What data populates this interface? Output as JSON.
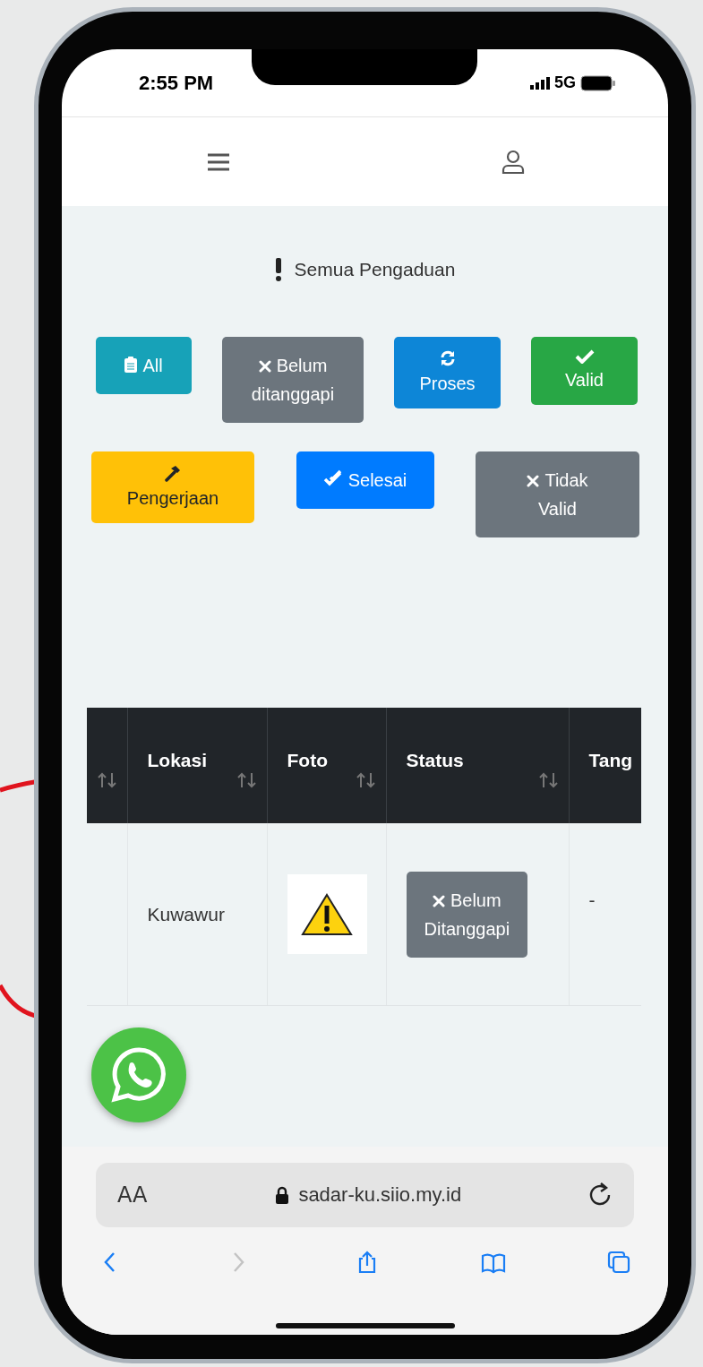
{
  "status_bar": {
    "time": "2:55 PM",
    "network": "5G"
  },
  "page_title": "Semua Pengaduan",
  "filter_rows": [
    [
      {
        "label": "All",
        "kind": "all",
        "color": "#17a2b8"
      },
      {
        "label": "Belum\nditanggapi",
        "kind": "pending",
        "color": "#6c757d"
      },
      {
        "label": "Proses",
        "kind": "process",
        "color": "#0d86d7"
      },
      {
        "label": "Valid",
        "kind": "valid",
        "color": "#28a745"
      }
    ],
    [
      {
        "label": "Pengerjaan",
        "kind": "work",
        "color": "#ffc107"
      },
      {
        "label": "Selesai",
        "kind": "done",
        "color": "#007bff"
      },
      {
        "label": "Tidak\nValid",
        "kind": "invalid",
        "color": "#6c757d"
      }
    ]
  ],
  "table": {
    "columns": [
      "Lokasi",
      "Foto",
      "Status",
      "Tang"
    ],
    "rows": [
      {
        "lokasi": "Kuwawur",
        "status": "Belum\nDitanggapi",
        "column_5": "-"
      }
    ]
  },
  "browser": {
    "text_size": "AA",
    "url": "sadar-ku.siio.my.id",
    "toolbar": [
      {
        "kind": "back",
        "disabled": false
      },
      {
        "kind": "forward",
        "disabled": true
      },
      {
        "kind": "share",
        "disabled": false
      },
      {
        "kind": "bookmarks",
        "disabled": false
      },
      {
        "kind": "tabs",
        "disabled": false
      }
    ]
  }
}
